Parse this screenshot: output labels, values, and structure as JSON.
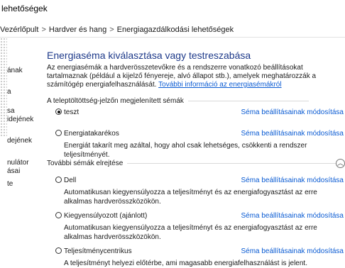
{
  "window": {
    "title": "lehetőségek"
  },
  "address": {
    "crumbs": [
      "Vezérlőpult",
      "Hardver és hang",
      "Energiagazdálkodási lehetőségek"
    ],
    "separator": ">"
  },
  "sidebar": {
    "items": [
      "ának",
      "a",
      "sa",
      "idejének",
      "dejének",
      "nulátor",
      "ásai",
      "te"
    ]
  },
  "main": {
    "heading": "Energiaséma kiválasztása vagy testreszabása",
    "description": "Az energiasémák a hardverösszetevőkre és a rendszerre vonatkozó beállításokat tartalmaznak (például a kijelző fényereje, alvó állapot stb.), amelyek meghatározzák a számítógép energiafelhasználását.",
    "description_link": "További információ az energiasémákról",
    "section_battery": "A teleptöltöttség-jelzőn megjelenített sémák",
    "section_hidden": "További sémák elrejtése",
    "plans": [
      {
        "name": "teszt",
        "selected": true,
        "link": "Séma beállításainak módosítása",
        "desc": ""
      },
      {
        "name": "Energiatakarékos",
        "selected": false,
        "link": "Séma beállításainak módosítása",
        "desc": "Energiát takarít meg azáltal, hogy ahol csak lehetséges, csökkenti a rendszer teljesítményét."
      },
      {
        "name": "Dell",
        "selected": false,
        "link": "Séma beállításainak módosítása",
        "desc": "Automatikusan kiegyensúlyozza a teljesítményt és az energiafogyasztást az erre alkalmas hardverösszközökön."
      },
      {
        "name": "Kiegyensúlyozott (ajánlott)",
        "selected": false,
        "link": "Séma beállításainak módosítása",
        "desc": "Automatikusan kiegyensúlyozza a teljesítményt és az energiafogyasztást az erre alkalmas hardverösszközökön."
      },
      {
        "name": "Teljesítménycentrikus",
        "selected": false,
        "link": "Séma beállításainak módosítása",
        "desc": "A teljesítményt helyezi előtérbe, ami magasabb energiafelhasználást is jelent."
      }
    ]
  },
  "icons": {
    "collapse": "chevron-up-icon"
  },
  "colors": {
    "heading": "#1e3a8a",
    "link": "#0a5bd3"
  }
}
